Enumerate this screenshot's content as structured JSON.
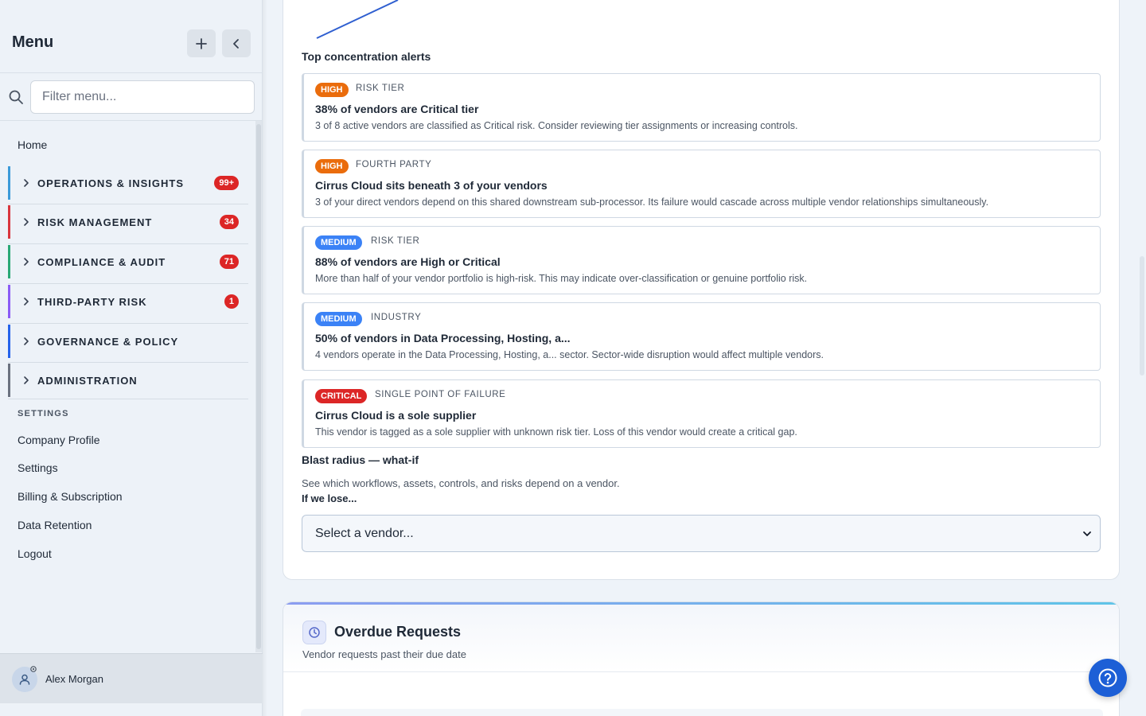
{
  "sidebar": {
    "title": "Menu",
    "filter_placeholder": "Filter menu...",
    "home": "Home",
    "groups": [
      {
        "label": "OPERATIONS & INSIGHTS",
        "badge": "99+",
        "color": "#3b9ad9"
      },
      {
        "label": "RISK MANAGEMENT",
        "badge": "34",
        "color": "#d9363e"
      },
      {
        "label": "COMPLIANCE & AUDIT",
        "badge": "71",
        "color": "#2aa876"
      },
      {
        "label": "THIRD-PARTY RISK",
        "badge": "1",
        "color": "#8b5cf6"
      },
      {
        "label": "GOVERNANCE & POLICY",
        "badge": "",
        "color": "#2563eb"
      },
      {
        "label": "ADMINISTRATION",
        "badge": "",
        "color": "#6b7280"
      }
    ],
    "settings_heading": "SETTINGS",
    "settings_items": [
      "Company Profile",
      "Settings",
      "Billing & Subscription",
      "Data Retention",
      "Logout"
    ],
    "user_name": "Alex Morgan"
  },
  "main": {
    "alerts_title": "Top concentration alerts",
    "alerts": [
      {
        "severity": "HIGH",
        "category": "RISK TIER",
        "title": "38% of vendors are Critical tier",
        "description": "3 of 8 active vendors are classified as Critical risk. Consider reviewing tier assignments or increasing controls."
      },
      {
        "severity": "HIGH",
        "category": "FOURTH PARTY",
        "title": "Cirrus Cloud sits beneath 3 of your vendors",
        "description": "3 of your direct vendors depend on this shared downstream sub-processor. Its failure would cascade across multiple vendor relationships simultaneously."
      },
      {
        "severity": "MEDIUM",
        "category": "RISK TIER",
        "title": "88% of vendors are High or Critical",
        "description": "More than half of your vendor portfolio is high-risk. This may indicate over-classification or genuine portfolio risk."
      },
      {
        "severity": "MEDIUM",
        "category": "INDUSTRY",
        "title": "50% of vendors in Data Processing, Hosting, a...",
        "description": "4 vendors operate in the Data Processing, Hosting, a... sector. Sector-wide disruption would affect multiple vendors."
      },
      {
        "severity": "CRITICAL",
        "category": "SINGLE POINT OF FAILURE",
        "title": "Cirrus Cloud is a sole supplier",
        "description": "This vendor is tagged as a sole supplier with unknown risk tier. Loss of this vendor would create a critical gap."
      }
    ],
    "blast_title": "Blast radius — what-if",
    "blast_description": "See which workflows, assets, controls, and risks depend on a vendor.",
    "blast_question": "If we lose...",
    "vendor_select_value": "Select a vendor...",
    "overdue_title": "Overdue Requests",
    "overdue_subtitle": "Vendor requests past their due date"
  },
  "colors": {
    "high": "#ea6c0c",
    "medium": "#3b82f6",
    "critical": "#dc2626",
    "accent": "#1d5fd6"
  }
}
